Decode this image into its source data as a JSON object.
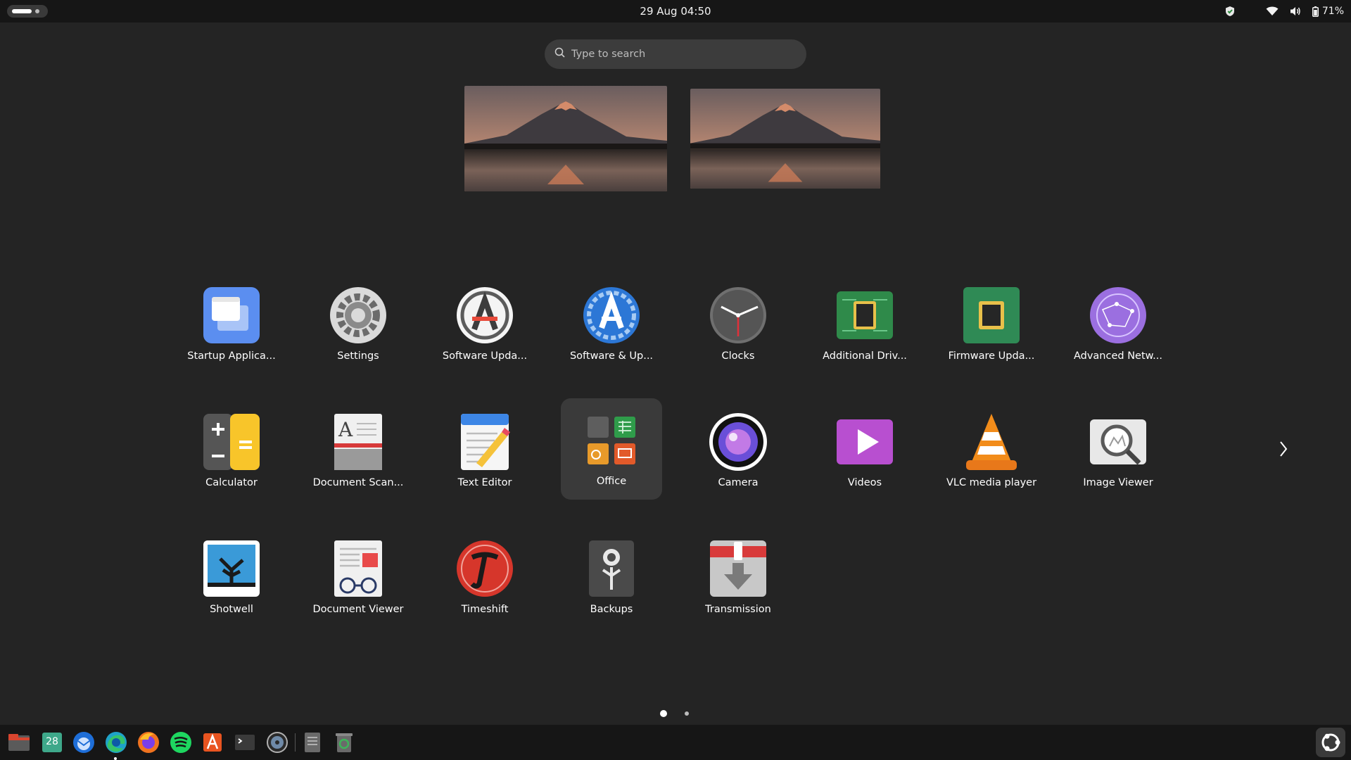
{
  "topbar": {
    "clock": "29 Aug  04:50",
    "battery": "71%"
  },
  "search": {
    "placeholder": "Type to search"
  },
  "apps": [
    {
      "label": "Startup Applica...",
      "icon": "startup-applications-icon"
    },
    {
      "label": "Settings",
      "icon": "settings-icon"
    },
    {
      "label": "Software Upda...",
      "icon": "software-updater-icon"
    },
    {
      "label": "Software & Up...",
      "icon": "software-and-updates-icon"
    },
    {
      "label": "Clocks",
      "icon": "clocks-icon"
    },
    {
      "label": "Additional Driv...",
      "icon": "additional-drivers-icon"
    },
    {
      "label": "Firmware Upda...",
      "icon": "firmware-updater-icon"
    },
    {
      "label": "Advanced Netw...",
      "icon": "advanced-network-icon"
    },
    {
      "label": "Calculator",
      "icon": "calculator-icon"
    },
    {
      "label": "Document Scan...",
      "icon": "document-scanner-icon"
    },
    {
      "label": "Text Editor",
      "icon": "text-editor-icon"
    },
    {
      "label": "Office",
      "icon": "office-folder-icon"
    },
    {
      "label": "Camera",
      "icon": "camera-icon"
    },
    {
      "label": "Videos",
      "icon": "videos-icon"
    },
    {
      "label": "VLC media player",
      "icon": "vlc-icon"
    },
    {
      "label": "Image Viewer",
      "icon": "image-viewer-icon"
    },
    {
      "label": "Shotwell",
      "icon": "shotwell-icon"
    },
    {
      "label": "Document Viewer",
      "icon": "document-viewer-icon"
    },
    {
      "label": "Timeshift",
      "icon": "timeshift-icon"
    },
    {
      "label": "Backups",
      "icon": "backups-icon"
    },
    {
      "label": "Transmission",
      "icon": "transmission-icon"
    }
  ],
  "pagination": {
    "pages": 2,
    "current": 1
  },
  "dock": {
    "calendar_day": "28",
    "items": [
      "files-icon",
      "calendar-icon",
      "thunderbird-icon",
      "edge-icon",
      "firefox-icon",
      "spotify-icon",
      "app-center-icon",
      "terminal-icon",
      "disk-usage-icon",
      "file-manager-icon",
      "trash-icon"
    ]
  },
  "colors": {
    "background": "#242424",
    "panel": "#161616",
    "selected_tile": "#3a3a3a"
  }
}
